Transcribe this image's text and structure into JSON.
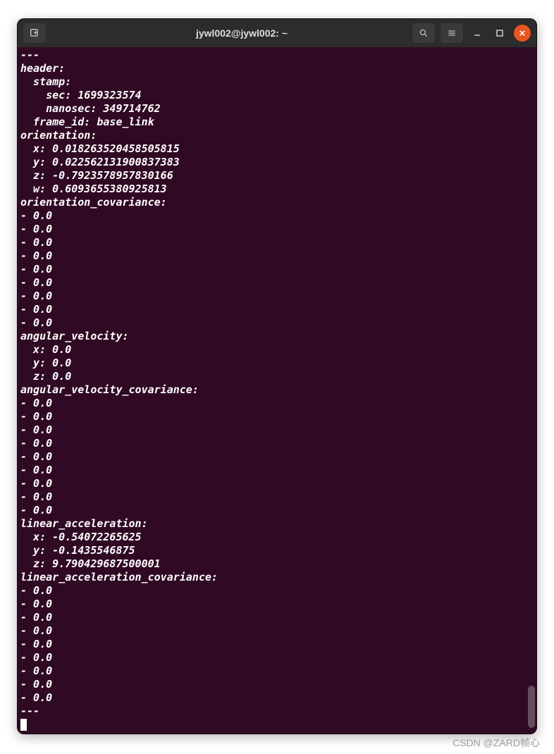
{
  "titlebar": {
    "title": "jywl002@jywl002: ~"
  },
  "terminal": {
    "lines": [
      "---",
      "header:",
      "  stamp:",
      "    sec: 1699323574",
      "    nanosec: 349714762",
      "  frame_id: base_link",
      "orientation:",
      "  x: 0.018263520458505815",
      "  y: 0.022562131900837383",
      "  z: -0.7923578957830166",
      "  w: 0.6093655380925813",
      "orientation_covariance:",
      "- 0.0",
      "- 0.0",
      "- 0.0",
      "- 0.0",
      "- 0.0",
      "- 0.0",
      "- 0.0",
      "- 0.0",
      "- 0.0",
      "angular_velocity:",
      "  x: 0.0",
      "  y: 0.0",
      "  z: 0.0",
      "angular_velocity_covariance:",
      "- 0.0",
      "- 0.0",
      "- 0.0",
      "- 0.0",
      "- 0.0",
      "- 0.0",
      "- 0.0",
      "- 0.0",
      "- 0.0",
      "linear_acceleration:",
      "  x: -0.54072265625",
      "  y: -0.1435546875",
      "  z: 9.790429687500001",
      "linear_acceleration_covariance:",
      "- 0.0",
      "- 0.0",
      "- 0.0",
      "- 0.0",
      "- 0.0",
      "- 0.0",
      "- 0.0",
      "- 0.0",
      "- 0.0",
      "---"
    ]
  },
  "watermark": "CSDN @ZARD帧心"
}
